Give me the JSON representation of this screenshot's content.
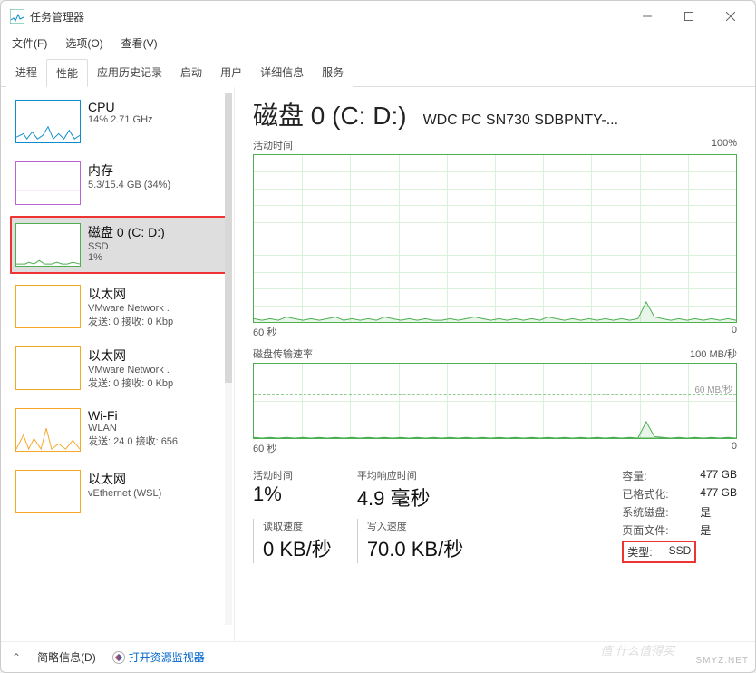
{
  "window": {
    "title": "任务管理器"
  },
  "menu": {
    "file": "文件(F)",
    "options": "选项(O)",
    "view": "查看(V)"
  },
  "tabs": [
    "进程",
    "性能",
    "应用历史记录",
    "启动",
    "用户",
    "详细信息",
    "服务"
  ],
  "active_tab": 1,
  "sidebar": [
    {
      "title": "CPU",
      "line1": "14% 2.71 GHz",
      "line2": "",
      "color": "blue",
      "selected": false
    },
    {
      "title": "内存",
      "line1": "5.3/15.4 GB (34%)",
      "line2": "",
      "color": "purple",
      "selected": false
    },
    {
      "title": "磁盘 0 (C: D:)",
      "line1": "SSD",
      "line2": "1%",
      "color": "green",
      "selected": true
    },
    {
      "title": "以太网",
      "line1": "VMware Network .",
      "line2": "发送: 0 接收: 0 Kbp",
      "color": "orange",
      "selected": false
    },
    {
      "title": "以太网",
      "line1": "VMware Network .",
      "line2": "发送: 0 接收: 0 Kbp",
      "color": "orange",
      "selected": false
    },
    {
      "title": "Wi-Fi",
      "line1": "WLAN",
      "line2": "发送: 24.0 接收: 656",
      "color": "orange",
      "selected": false
    },
    {
      "title": "以太网",
      "line1": "vEthernet (WSL)",
      "line2": "",
      "color": "orange",
      "selected": false
    }
  ],
  "detail": {
    "title": "磁盘 0 (C: D:)",
    "model": "WDC PC SN730 SDBPNTY-...",
    "chart1": {
      "label": "活动时间",
      "max": "100%",
      "x_left": "60 秒",
      "x_right": "0"
    },
    "chart2": {
      "label": "磁盘传输速率",
      "max": "100 MB/秒",
      "dashed": "60 MB/秒",
      "x_left": "60 秒",
      "x_right": "0"
    },
    "stats": {
      "active_time": {
        "label": "活动时间",
        "value": "1%"
      },
      "avg_response": {
        "label": "平均响应时间",
        "value": "4.9 毫秒"
      },
      "read_speed": {
        "label": "读取速度",
        "value": "0 KB/秒"
      },
      "write_speed": {
        "label": "写入速度",
        "value": "70.0 KB/秒"
      }
    },
    "info": {
      "capacity": {
        "k": "容量:",
        "v": "477 GB"
      },
      "formatted": {
        "k": "已格式化:",
        "v": "477 GB"
      },
      "system_disk": {
        "k": "系统磁盘:",
        "v": "是"
      },
      "page_file": {
        "k": "页面文件:",
        "v": "是"
      },
      "type": {
        "k": "类型:",
        "v": "SSD"
      }
    }
  },
  "footer": {
    "summary": "简略信息(D)",
    "monitor": "打开资源监视器"
  },
  "watermark": "SMYZ.NET",
  "watermark2": "值  什么值得买",
  "chart_data": [
    {
      "type": "line",
      "title": "活动时间",
      "ylabel": "%",
      "ylim": [
        0,
        100
      ],
      "xlabel": "秒",
      "x_range": [
        60,
        0
      ],
      "series": [
        {
          "name": "活动时间",
          "values": [
            2,
            1,
            2,
            1,
            3,
            2,
            1,
            2,
            1,
            2,
            3,
            1,
            2,
            1,
            2,
            1,
            3,
            2,
            1,
            2,
            1,
            2,
            1,
            1,
            2,
            1,
            2,
            3,
            2,
            1,
            2,
            1,
            2,
            1,
            2,
            1,
            3,
            2,
            1,
            2,
            1,
            2,
            1,
            2,
            1,
            2,
            1,
            2,
            12,
            3,
            2,
            1,
            2,
            1,
            2,
            1,
            2,
            1,
            2,
            1
          ]
        }
      ]
    },
    {
      "type": "line",
      "title": "磁盘传输速率",
      "ylabel": "MB/秒",
      "ylim": [
        0,
        100
      ],
      "xlabel": "秒",
      "x_range": [
        60,
        0
      ],
      "series": [
        {
          "name": "读取",
          "values": [
            0,
            0,
            0,
            0,
            0,
            0,
            0,
            0,
            0,
            0,
            0,
            0,
            0,
            0,
            0,
            0,
            0,
            0,
            0,
            0,
            0,
            0,
            0,
            0,
            0,
            0,
            0,
            0,
            0,
            0,
            0,
            0,
            0,
            0,
            0,
            0,
            0,
            0,
            0,
            0,
            0,
            0,
            0,
            0,
            0,
            0,
            0,
            0,
            0,
            0,
            0,
            0,
            0,
            0,
            0,
            0,
            0,
            0,
            0,
            0
          ]
        },
        {
          "name": "写入",
          "values": [
            1,
            0,
            1,
            0,
            1,
            0,
            1,
            0,
            1,
            0,
            1,
            0,
            1,
            0,
            1,
            0,
            1,
            0,
            1,
            0,
            1,
            0,
            1,
            0,
            1,
            0,
            1,
            0,
            1,
            0,
            1,
            0,
            1,
            0,
            1,
            0,
            1,
            0,
            1,
            0,
            1,
            0,
            1,
            0,
            1,
            0,
            1,
            0,
            22,
            2,
            1,
            0,
            1,
            0,
            1,
            0,
            1,
            0,
            1,
            0
          ]
        }
      ]
    }
  ]
}
